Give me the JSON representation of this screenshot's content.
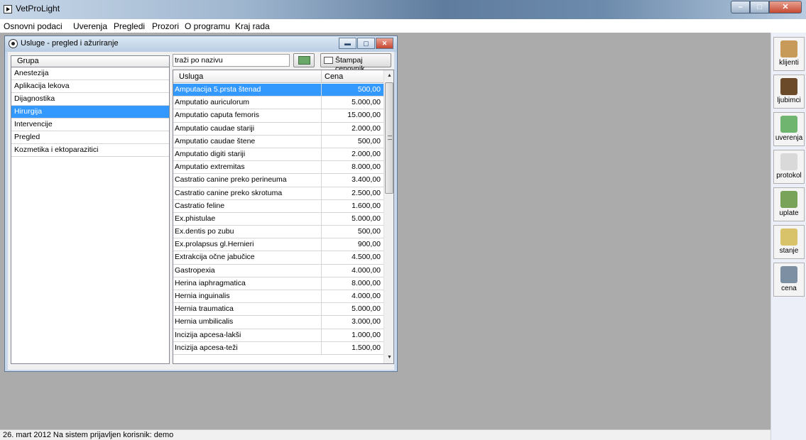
{
  "app": {
    "title": "VetProLight"
  },
  "menu": [
    "Osnovni podaci",
    "Uverenja",
    "Pregledi",
    "Prozori",
    "O programu",
    "Kraj rada"
  ],
  "window": {
    "title": "Usluge - pregled i ažuriranje",
    "group_header": "Grupa",
    "groups": [
      "Anestezija",
      "Aplikacija lekova",
      "Dijagnostika",
      "Hirurgija",
      "Intervencije",
      "Pregled",
      "Kozmetika i ektoparazitici"
    ],
    "selected_group": "Hirurgija",
    "search_value": "traži po nazivu",
    "print_label": "Štampaj cenovnik",
    "table": {
      "columns": [
        "Usluga",
        "Cena"
      ],
      "rows": [
        [
          "Amputacija 5.prsta štenad",
          "500,00"
        ],
        [
          "Amputatio auriculorum",
          "5.000,00"
        ],
        [
          "Amputatio caputa femoris",
          "15.000,00"
        ],
        [
          "Amputatio caudae stariji",
          "2.000,00"
        ],
        [
          "Amputatio caudae štene",
          "500,00"
        ],
        [
          "Amputatio digiti stariji",
          "2.000,00"
        ],
        [
          "Amputatio extremitas",
          "8.000,00"
        ],
        [
          "Castratio canine preko perineuma",
          "3.400,00"
        ],
        [
          "Castratio canine preko skrotuma",
          "2.500,00"
        ],
        [
          "Castratio feline",
          "1.600,00"
        ],
        [
          "Ex.phistulae",
          "5.000,00"
        ],
        [
          "Ex.dentis po zubu",
          "500,00"
        ],
        [
          "Ex.prolapsus gl.Hernieri",
          "900,00"
        ],
        [
          "Extrakcija očne jabučice",
          "4.500,00"
        ],
        [
          "Gastropexia",
          "4.000,00"
        ],
        [
          "Herina iaphragmatica",
          "8.000,00"
        ],
        [
          "Hernia inguinalis",
          "4.000,00"
        ],
        [
          "Hernia traumatica",
          "5.000,00"
        ],
        [
          "Hernia umbilicalis",
          "3.000,00"
        ],
        [
          "Incizija apcesa-lakši",
          "1.000,00"
        ],
        [
          "Incizija apcesa-teži",
          "1.500,00"
        ]
      ],
      "selected_row": 0
    }
  },
  "toolbar": [
    {
      "label": "klijenti",
      "icon": "clients-icon",
      "color": "#c89a5a"
    },
    {
      "label": "ljubimci",
      "icon": "pets-icon",
      "color": "#6b4a2a"
    },
    {
      "label": "uverenja",
      "icon": "certificate-icon",
      "color": "#6fb56f"
    },
    {
      "label": "protokol",
      "icon": "protocol-icon",
      "color": "#d9d9d9"
    },
    {
      "label": "uplate",
      "icon": "payments-icon",
      "color": "#7aa35a"
    },
    {
      "label": "stanje",
      "icon": "balance-icon",
      "color": "#d8c36a"
    },
    {
      "label": "cena",
      "icon": "calculator-icon",
      "color": "#7d8fa3"
    }
  ],
  "status": "26. mart 2012  Na sistem prijavljen korisnik:  demo"
}
